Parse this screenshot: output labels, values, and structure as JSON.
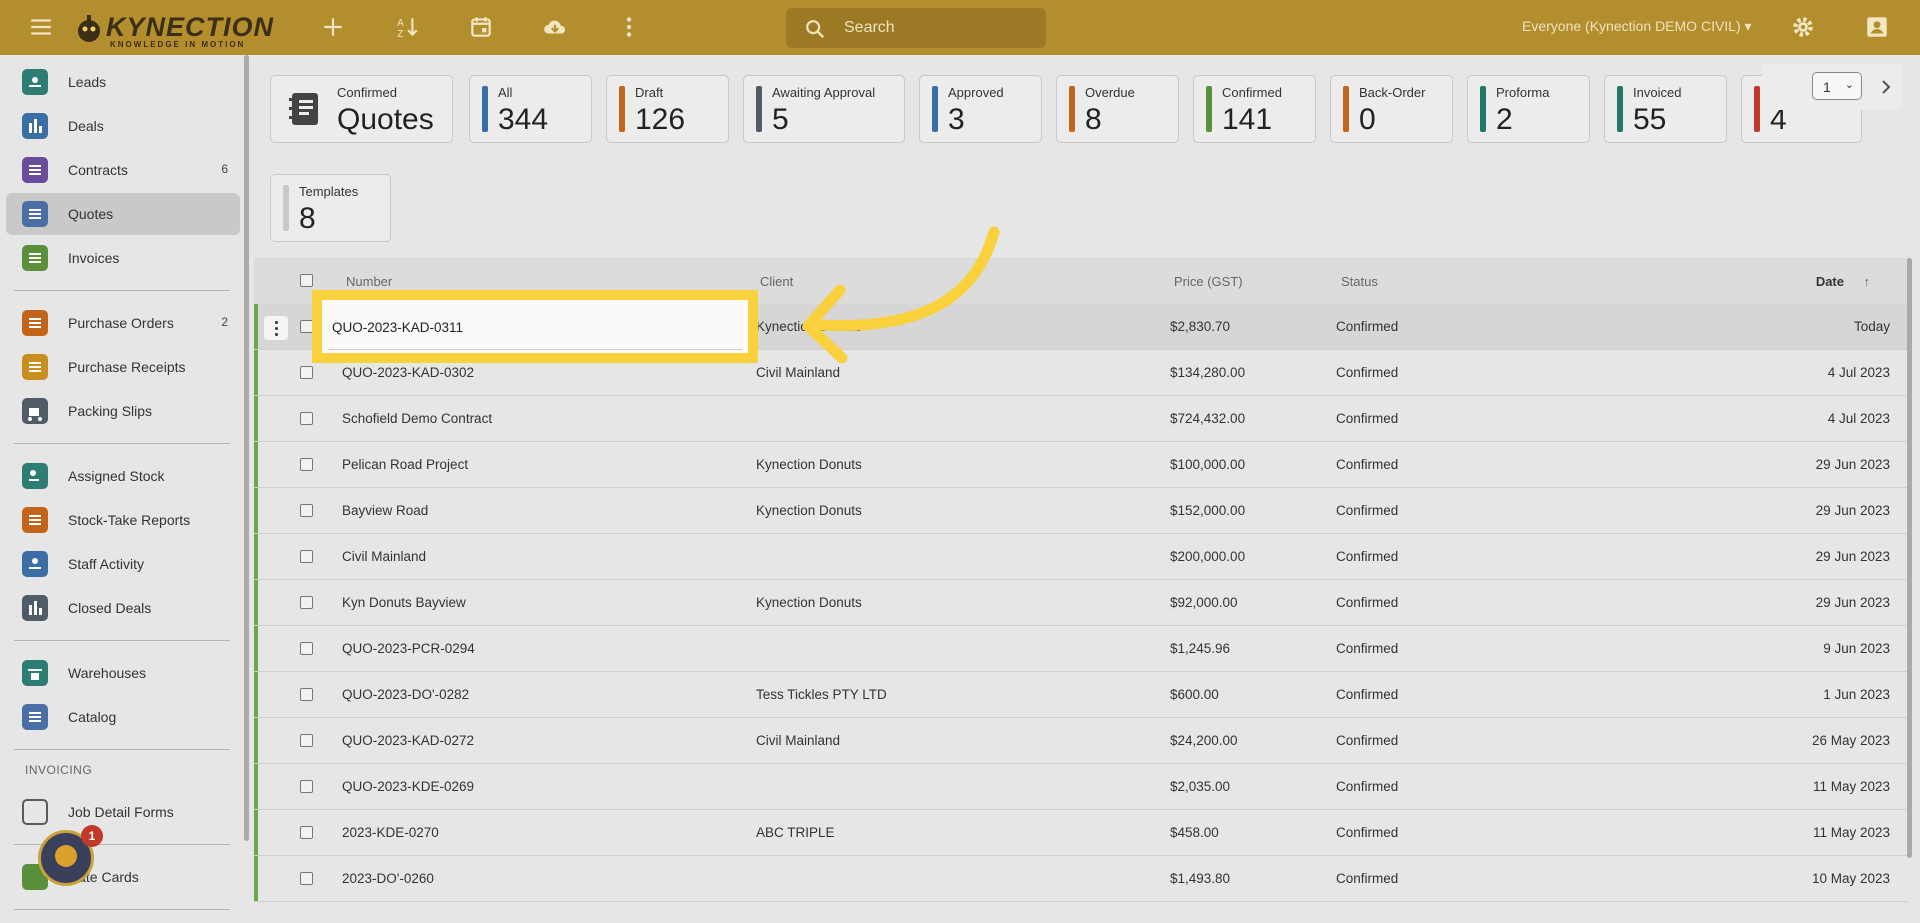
{
  "topbar": {
    "brand": "KYNECTION",
    "tagline": "KNOWLEDGE IN MOTION",
    "search_placeholder": "Search",
    "workspace": "Everyone (Kynection DEMO CIVIL) ▾",
    "icons": [
      "menu-icon",
      "add-icon",
      "sort-icon",
      "calendar-icon",
      "cloud-download-icon",
      "more-vert-icon",
      "search-icon",
      "gear-icon",
      "account-icon"
    ]
  },
  "sidebar": {
    "items": [
      {
        "label": "Leads",
        "color": "#2e7d74"
      },
      {
        "label": "Deals",
        "color": "#3a6ea5"
      },
      {
        "label": "Contracts",
        "badge": "6",
        "color": "#6a4c9c"
      },
      {
        "label": "Quotes",
        "color": "#4a6fa5"
      },
      {
        "label": "Invoices",
        "color": "#5a8f3c"
      },
      {
        "label": "Purchase Orders",
        "badge": "2",
        "color": "#c2651a"
      },
      {
        "label": "Purchase Receipts",
        "color": "#c98f1e"
      },
      {
        "label": "Packing Slips",
        "color": "#4f5b66"
      },
      {
        "label": "Assigned Stock",
        "color": "#2e7d74"
      },
      {
        "label": "Stock-Take Reports",
        "color": "#c2651a"
      },
      {
        "label": "Staff Activity",
        "color": "#3a6ea5"
      },
      {
        "label": "Closed Deals",
        "color": "#4f5b66"
      },
      {
        "label": "Warehouses",
        "color": "#2e7d74"
      },
      {
        "label": "Catalog",
        "color": "#4a6fa5"
      },
      {
        "label": "Job Detail Forms",
        "color": "#5a5a5a"
      },
      {
        "label": "Rate Cards",
        "color": "#5a8f3c"
      }
    ],
    "section_invoicing": "INVOICING",
    "bot_badge": "1"
  },
  "summary": {
    "main_label": "Confirmed",
    "main_value": "Quotes",
    "cards": [
      {
        "label": "All",
        "value": "344",
        "color": "#3a6ea5"
      },
      {
        "label": "Draft",
        "value": "126",
        "color": "#c2651a"
      },
      {
        "label": "Awaiting Approval",
        "value": "5",
        "color": "#4f5b66"
      },
      {
        "label": "Approved",
        "value": "3",
        "color": "#3a6ea5"
      },
      {
        "label": "Overdue",
        "value": "8",
        "color": "#c2651a"
      },
      {
        "label": "Confirmed",
        "value": "141",
        "color": "#5a8f3c"
      },
      {
        "label": "Back-Order",
        "value": "0",
        "color": "#c2651a"
      },
      {
        "label": "Proforma",
        "value": "2",
        "color": "#1f7a6a"
      },
      {
        "label": "Invoiced",
        "value": "55",
        "color": "#1f7a6a"
      },
      {
        "label": "",
        "value": "4",
        "color": "#c0392b"
      },
      {
        "label": "Templates",
        "value": "8",
        "color": "#c9c9c9"
      }
    ],
    "page": "1"
  },
  "table": {
    "columns": {
      "number": "Number",
      "client": "Client",
      "price": "Price (GST)",
      "status": "Status",
      "date": "Date",
      "sort": "↑"
    },
    "rows": [
      {
        "number": "QUO-2023-KAD-0311",
        "client": "Kynection Donuts",
        "price": "$2,830.70",
        "status": "Confirmed",
        "date": "Today"
      },
      {
        "number": "QUO-2023-KAD-0302",
        "client": "Civil Mainland",
        "price": "$134,280.00",
        "status": "Confirmed",
        "date": "4 Jul 2023"
      },
      {
        "number": "Schofield Demo Contract",
        "client": "",
        "price": "$724,432.00",
        "status": "Confirmed",
        "date": "4 Jul 2023"
      },
      {
        "number": "Pelican Road Project",
        "client": "Kynection Donuts",
        "price": "$100,000.00",
        "status": "Confirmed",
        "date": "29 Jun 2023"
      },
      {
        "number": "Bayview Road",
        "client": "Kynection Donuts",
        "price": "$152,000.00",
        "status": "Confirmed",
        "date": "29 Jun 2023"
      },
      {
        "number": "Civil Mainland",
        "client": "",
        "price": "$200,000.00",
        "status": "Confirmed",
        "date": "29 Jun 2023"
      },
      {
        "number": "Kyn Donuts Bayview",
        "client": "Kynection Donuts",
        "price": "$92,000.00",
        "status": "Confirmed",
        "date": "29 Jun 2023"
      },
      {
        "number": "QUO-2023-PCR-0294",
        "client": "",
        "price": "$1,245.96",
        "status": "Confirmed",
        "date": "9 Jun 2023"
      },
      {
        "number": "QUO-2023-DO'-0282",
        "client": "Tess Tickles PTY LTD",
        "price": "$600.00",
        "status": "Confirmed",
        "date": "1 Jun 2023"
      },
      {
        "number": "QUO-2023-KAD-0272",
        "client": "Civil Mainland",
        "price": "$24,200.00",
        "status": "Confirmed",
        "date": "26 May 2023"
      },
      {
        "number": "QUO-2023-KDE-0269",
        "client": "",
        "price": "$2,035.00",
        "status": "Confirmed",
        "date": "11 May 2023"
      },
      {
        "number": "2023-KDE-0270",
        "client": "ABC TRIPLE",
        "price": "$458.00",
        "status": "Confirmed",
        "date": "11 May 2023"
      },
      {
        "number": "2023-DO'-0260",
        "client": "",
        "price": "$1,493.80",
        "status": "Confirmed",
        "date": "10 May 2023"
      }
    ]
  },
  "highlight": {
    "text": "QUO-2023-KAD-0311",
    "color": "#f8d13d"
  }
}
